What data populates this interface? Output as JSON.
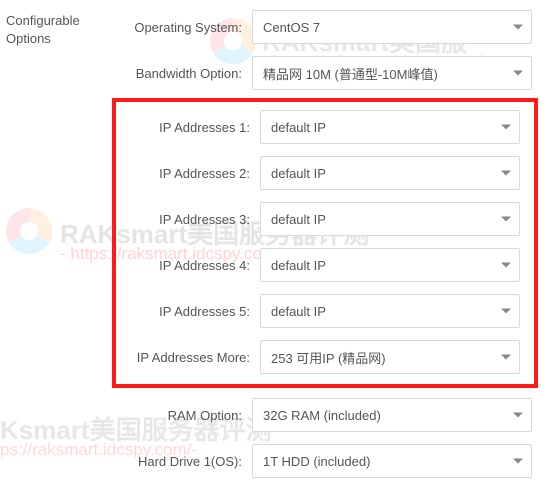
{
  "side_label_line1": "Configurable",
  "side_label_line2": "Options",
  "rows": {
    "os": {
      "label": "Operating System:",
      "value": "CentOS 7"
    },
    "bw": {
      "label": "Bandwidth Option:",
      "value": "精品网 10M (普通型-10M峰值)"
    },
    "ip1": {
      "label": "IP Addresses 1:",
      "value": "default IP"
    },
    "ip2": {
      "label": "IP Addresses 2:",
      "value": "default IP"
    },
    "ip3": {
      "label": "IP Addresses 3:",
      "value": "default IP"
    },
    "ip4": {
      "label": "IP Addresses 4:",
      "value": "default IP"
    },
    "ip5": {
      "label": "IP Addresses 5:",
      "value": "default IP"
    },
    "ipmore": {
      "label": "IP Addresses More:",
      "value": "253 可用IP (精品网)"
    },
    "ram": {
      "label": "RAM Option:",
      "value": "32G RAM (included)"
    },
    "hd1": {
      "label": "Hard Drive 1(OS):",
      "value": "1T HDD (included)"
    }
  },
  "watermarks": {
    "brand_cn": "RAKsmart美国服务器评测",
    "brand_cn_short": "Ksmart美国服务器评测",
    "brand_url_a": "- https://raksmart.idcspy.com/-",
    "brand_url_b": "ps://raksmart.idcspy.com/-",
    "brand_head": "RAKsmart美国服"
  }
}
